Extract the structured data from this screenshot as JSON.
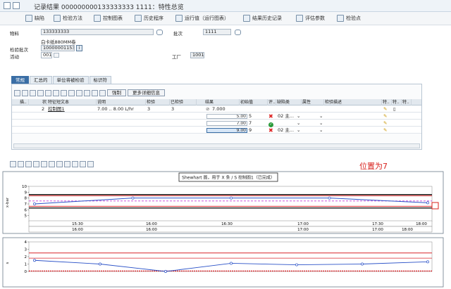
{
  "window": {
    "title": "记录结果 000000000133333333 1111：特性总览"
  },
  "toolbar": [
    {
      "label": "缺陷",
      "icon": "document-icon"
    },
    {
      "label": "检验方法",
      "icon": "document-icon"
    },
    {
      "label": "控制图表",
      "icon": "chart-icon"
    },
    {
      "label": "历史程序",
      "icon": "document-icon"
    },
    {
      "label": "运行值（运行图表）",
      "icon": "chart-icon"
    },
    {
      "label": "结果历史记录",
      "icon": "history-icon"
    },
    {
      "label": "评估参数",
      "icon": "evaluation-icon"
    },
    {
      "label": "检验点",
      "icon": "inspection-point-icon"
    }
  ],
  "header": {
    "material_label": "物料",
    "material_value": "133333333",
    "material_desc": "白卡纸880MM卷",
    "batch_label": "批次",
    "batch_value": "1111",
    "lot_label": "检验批次",
    "lot_value": "10000001153",
    "lot_btn": "i",
    "op_label": "活动",
    "op_value": "0010",
    "plant_label": "工厂",
    "plant_value": "1001"
  },
  "tabs": [
    "常规",
    "汇总的",
    "单位将被检验",
    "标识符"
  ],
  "grid": {
    "force_label": "强制",
    "more_label": "更多详细信息",
    "columns": [
      "描..",
      "状",
      "特征短文本",
      "说明",
      "检验",
      "已检验",
      "结果",
      "初始值",
      "评..",
      "缺陷类",
      "属性",
      "检验描述",
      "特..",
      "特..",
      "特.."
    ],
    "char_row": {
      "no": "2",
      "text": "控制图1",
      "spec": "7.00 .. 8.00 L/hr",
      "insp": "3",
      "done": "3",
      "result": "7.000"
    },
    "values": [
      {
        "result": "",
        "value": "5.00",
        "flag": "5",
        "eval": "reject",
        "defect": "02 主..."
      },
      {
        "result": "",
        "value": "7.00",
        "flag": "7",
        "eval": "accept",
        "defect": ""
      },
      {
        "result": "",
        "value": "9.00",
        "flag": "9",
        "eval": "reject",
        "defect": "02 主..."
      }
    ]
  },
  "chart": {
    "title": "Shewhart 图，用于 X 条 / S 控制图1（已完成）",
    "annotation": "位置为7",
    "top_ylabel": "x-bar",
    "bottom_ylabel": "s",
    "x_times": [
      "15:30",
      "16:00",
      "16:30",
      "17:00",
      "17:30",
      "18:00"
    ],
    "x_dates": [
      "16:00",
      "16:00",
      "17:00",
      "17:00",
      "18:00"
    ]
  },
  "chart_data": [
    {
      "type": "line",
      "title": "Shewhart 图，用于 X 条 / S 控制图1（已完成）",
      "ylabel": "x-bar",
      "ylim": [
        4,
        10
      ],
      "yticks": [
        5,
        6,
        7,
        8,
        9,
        10
      ],
      "series": [
        {
          "values": [
            7.0,
            8.0,
            8.0,
            8.0,
            7.2
          ]
        }
      ],
      "limits": {
        "upper_spec": 8.6,
        "upper_control": 8.4,
        "target": 7.5,
        "lower_control": 6.6,
        "lower_spec": 6.3
      }
    },
    {
      "type": "line",
      "ylabel": "s",
      "ylim": [
        0,
        4
      ],
      "yticks": [
        0,
        1,
        2,
        3,
        4
      ],
      "series": [
        {
          "values": [
            1.5,
            1.0,
            0.0,
            1.1,
            0.9,
            1.0,
            1.3
          ]
        }
      ],
      "limits": {
        "upper": 2.5,
        "center": 1.8,
        "lower": 0.05
      }
    }
  ]
}
